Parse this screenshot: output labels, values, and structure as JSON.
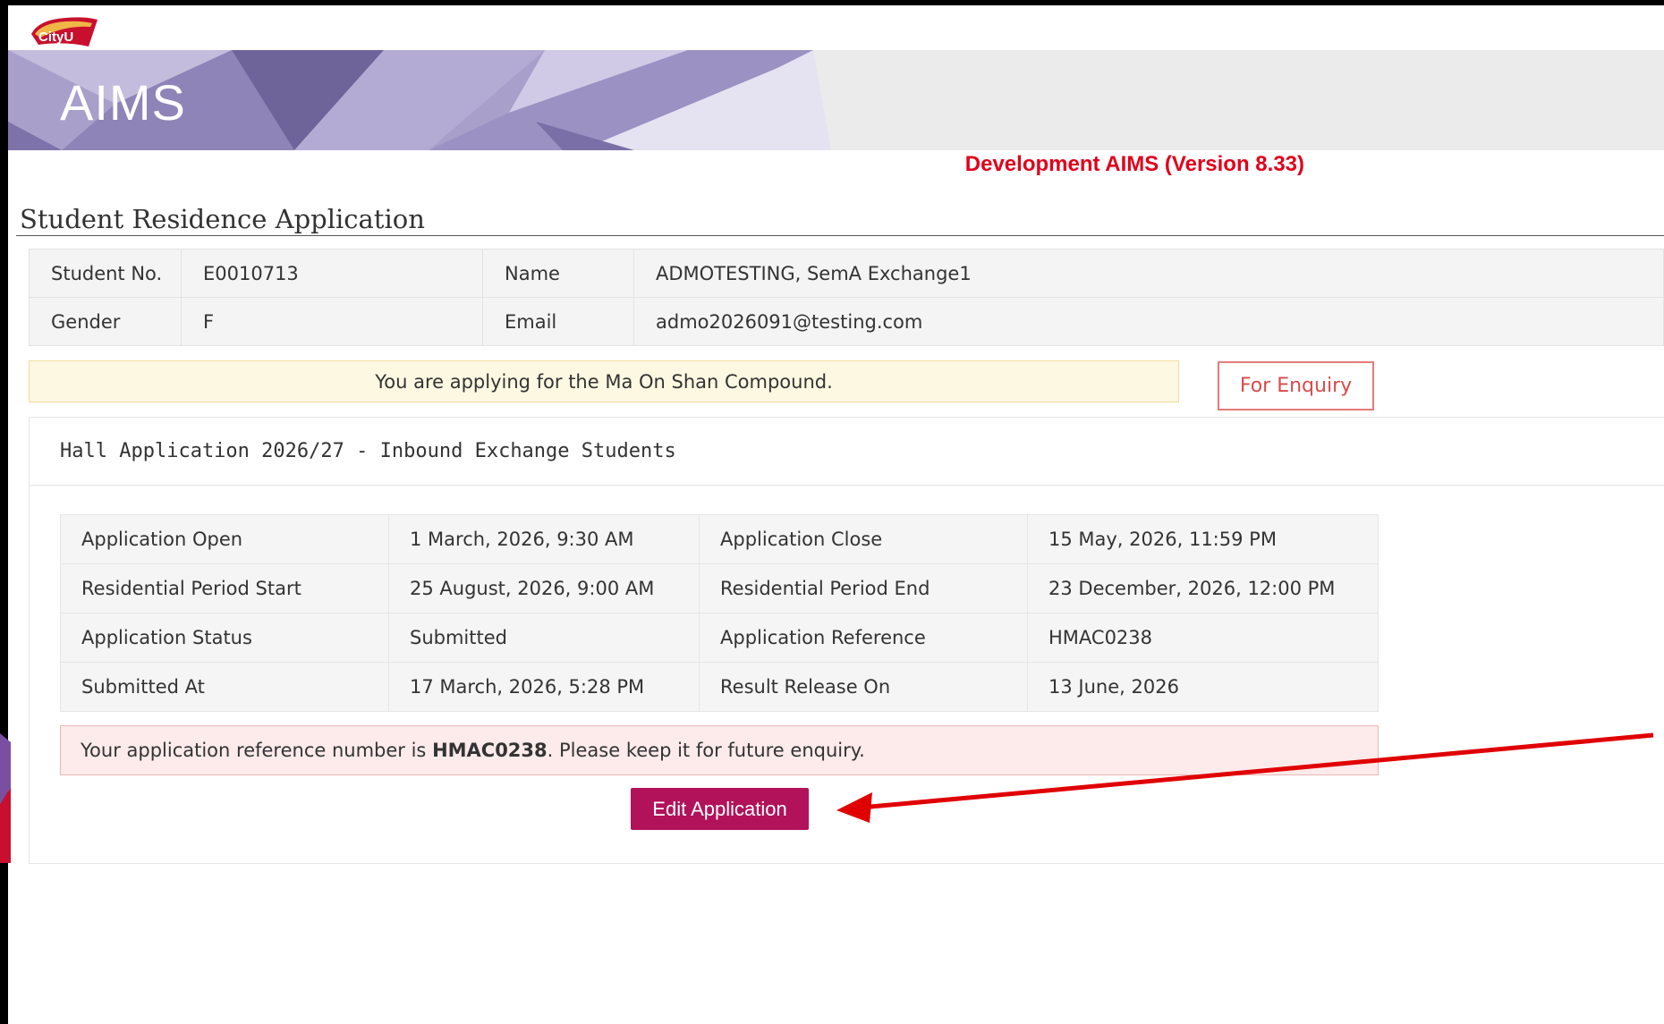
{
  "header": {
    "logo_text": "CityU",
    "app_title": "AIMS",
    "version_label": "Development AIMS (Version 8.33)"
  },
  "page": {
    "title": "Student Residence Application"
  },
  "student_info": {
    "student_no_label": "Student No.",
    "student_no": "E0010713",
    "name_label": "Name",
    "name": "ADMOTESTING, SemA Exchange1",
    "gender_label": "Gender",
    "gender": "F",
    "email_label": "Email",
    "email": "admo2026091@testing.com"
  },
  "notice": {
    "text": "You are applying for the Ma On Shan Compound.",
    "enquiry_button": "For Enquiry"
  },
  "application": {
    "heading": "Hall Application 2026/27 - Inbound Exchange Students",
    "rows": [
      {
        "label1": "Application Open",
        "value1": "1 March, 2026, 9:30 AM",
        "label2": "Application Close",
        "value2": "15 May, 2026, 11:59 PM"
      },
      {
        "label1": "Residential Period Start",
        "value1": "25 August, 2026, 9:00 AM",
        "label2": "Residential Period End",
        "value2": "23 December, 2026, 12:00 PM"
      },
      {
        "label1": "Application Status",
        "value1": "Submitted",
        "label2": "Application Reference",
        "value2": "HMAC0238"
      },
      {
        "label1": "Submitted At",
        "value1": "17 March, 2026, 5:28 PM",
        "label2": "Result Release On",
        "value2": "13 June, 2026"
      }
    ],
    "alert_prefix": "Your application reference number is ",
    "alert_reference": "HMAC0238",
    "alert_suffix": ". Please keep it for future enquiry.",
    "edit_button": "Edit Application"
  },
  "colors": {
    "brand_purple": "#9a8fbf",
    "version_red": "#e0001b",
    "edit_button": "#b2125a",
    "annotation_arrow": "#e00000"
  }
}
